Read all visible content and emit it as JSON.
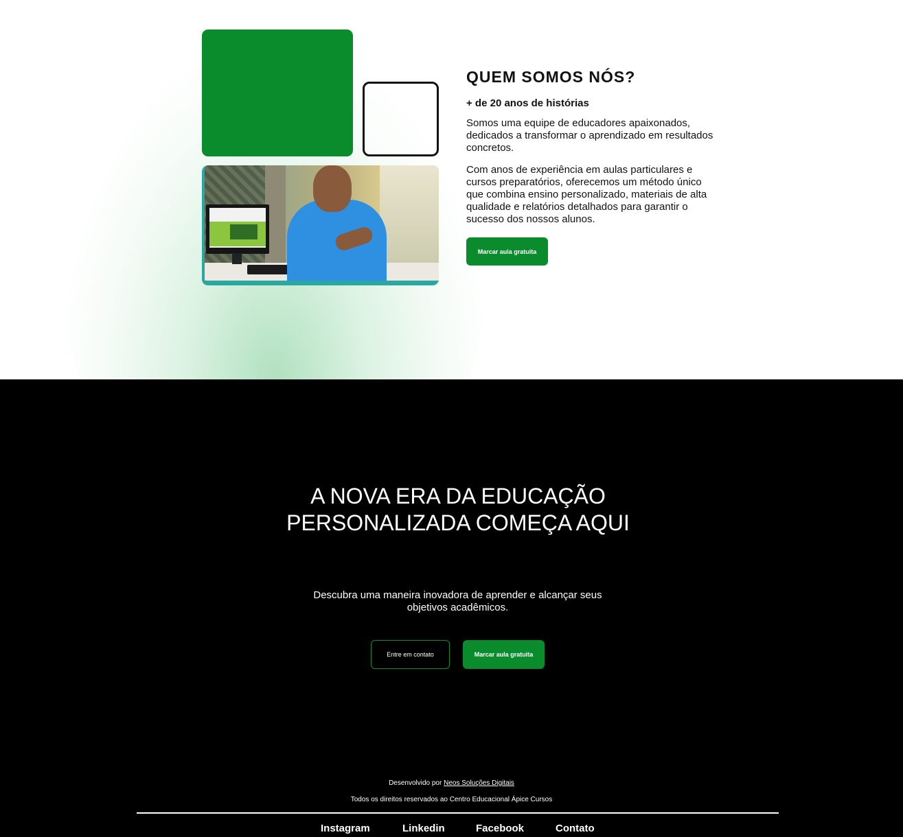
{
  "about": {
    "title": "QUEM SOMOS NÓS?",
    "subtitle": "+ de 20 anos de histórias",
    "paragraph1": "Somos uma equipe de educadores apaixonados, dedicados a transformar o aprendizado em resultados concretos.",
    "paragraph2": "Com anos de experiência em aulas particulares e cursos preparatórios, oferecemos um método único que combina ensino personalizado, materiais de alta qualidade e relatórios detalhados para garantir o sucesso dos nossos alunos.",
    "button_label": "Marcar aula gratuita"
  },
  "cta": {
    "title": "A NOVA ERA DA EDUCAÇÃO PERSONALIZADA COMEÇA AQUI",
    "subtitle": "Descubra uma maneira inovadora de aprender e alcançar seus objetivos acadêmicos.",
    "contact_button": "Entre em contato",
    "free_class_button": "Marcar aula gratuita"
  },
  "footer": {
    "dev_prefix": "Desenvolvido por",
    "dev_link": "Neos Soluções Digitais",
    "rights": "Todos os direitos reservados ao Centro Educacional Ápice Cursos",
    "links": [
      "Instagram",
      "Linkedin",
      "Facebook",
      "Contato"
    ]
  },
  "colors": {
    "brand_green": "#0a8c2d",
    "photo_border": "#2aa7a0",
    "dark_bg": "#000000"
  }
}
